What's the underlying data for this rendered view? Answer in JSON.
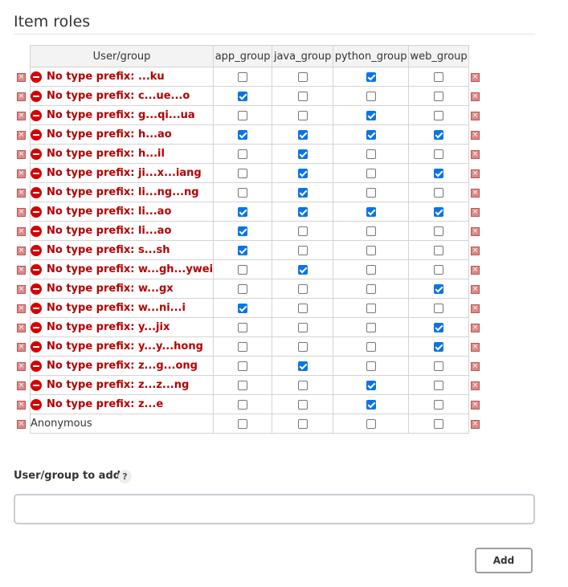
{
  "section": {
    "title": "Item roles"
  },
  "table": {
    "user_header": "User/group",
    "group_headers": [
      "app_group",
      "java_group",
      "python_group",
      "web_group"
    ],
    "rows": [
      {
        "label": "No type prefix: ...ku",
        "is_error": true,
        "checks": [
          false,
          false,
          true,
          false
        ]
      },
      {
        "label": "No type prefix: c...ue...o",
        "is_error": true,
        "checks": [
          true,
          false,
          false,
          false
        ]
      },
      {
        "label": "No type prefix: g...qi...ua",
        "is_error": true,
        "checks": [
          false,
          false,
          true,
          false
        ]
      },
      {
        "label": "No type prefix: h...ao",
        "is_error": true,
        "checks": [
          true,
          true,
          true,
          true
        ]
      },
      {
        "label": "No type prefix: h...il",
        "is_error": true,
        "checks": [
          false,
          true,
          false,
          false
        ]
      },
      {
        "label": "No type prefix: ji...x...iang",
        "is_error": true,
        "checks": [
          false,
          true,
          false,
          true
        ]
      },
      {
        "label": "No type prefix: li...ng...ng",
        "is_error": true,
        "checks": [
          false,
          true,
          false,
          false
        ]
      },
      {
        "label": "No type prefix: li...ao",
        "is_error": true,
        "checks": [
          true,
          true,
          true,
          true
        ]
      },
      {
        "label": "No type prefix: li...ao",
        "is_error": true,
        "checks": [
          true,
          false,
          false,
          false
        ]
      },
      {
        "label": "No type prefix: s...sh",
        "is_error": true,
        "checks": [
          true,
          false,
          false,
          false
        ]
      },
      {
        "label": "No type prefix: w...gh...ywei",
        "is_error": true,
        "checks": [
          false,
          true,
          false,
          false
        ]
      },
      {
        "label": "No type prefix: w...gx",
        "is_error": true,
        "checks": [
          false,
          false,
          false,
          true
        ]
      },
      {
        "label": "No type prefix: w...ni...i",
        "is_error": true,
        "checks": [
          true,
          false,
          false,
          false
        ]
      },
      {
        "label": "No type prefix: y...jix",
        "is_error": true,
        "checks": [
          false,
          false,
          false,
          true
        ]
      },
      {
        "label": "No type prefix: y...y...hong",
        "is_error": true,
        "checks": [
          false,
          false,
          false,
          true
        ]
      },
      {
        "label": "No type prefix: z...g...ong",
        "is_error": true,
        "checks": [
          false,
          true,
          false,
          false
        ]
      },
      {
        "label": "No type prefix: z...z...ng",
        "is_error": true,
        "checks": [
          false,
          false,
          true,
          false
        ]
      },
      {
        "label": "No type prefix: z...e",
        "is_error": true,
        "checks": [
          false,
          false,
          true,
          false
        ]
      },
      {
        "label": "Anonymous",
        "is_error": false,
        "checks": [
          false,
          false,
          false,
          false
        ]
      }
    ]
  },
  "add": {
    "label": "User/group to add",
    "help": "?",
    "input_value": "",
    "button": "Add"
  },
  "colors": {
    "error_text": "#b40000",
    "checkbox_checked": "#0b74e5",
    "delete_icon": "#d98a8a"
  },
  "icons": {
    "error": "error-circle-icon",
    "delete": "delete-x-icon",
    "help": "help-circle-icon"
  }
}
